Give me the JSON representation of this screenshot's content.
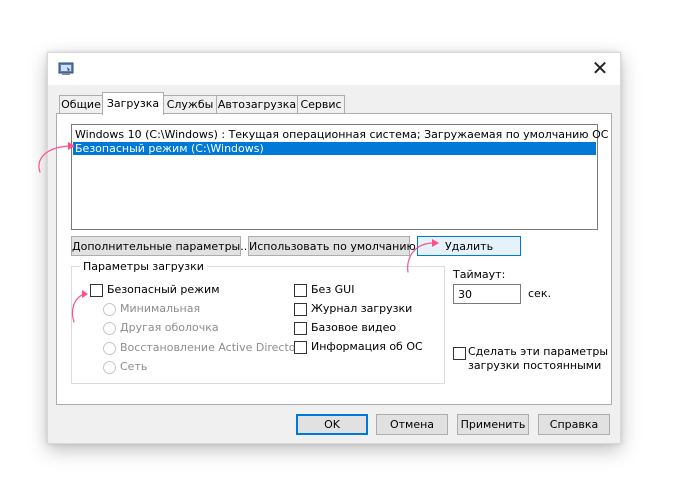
{
  "dialog": {
    "close_glyph": "✕",
    "tabs": [
      {
        "label": "Общие"
      },
      {
        "label": "Загрузка"
      },
      {
        "label": "Службы"
      },
      {
        "label": "Автозагрузка"
      },
      {
        "label": "Сервис"
      }
    ],
    "active_tab": "Загрузка"
  },
  "boot": {
    "os_entries": [
      {
        "label": "Windows 10 (C:\\Windows) : Текущая операционная система; Загружаемая по умолчанию ОС",
        "selected": false
      },
      {
        "label": "Безопасный режим (C:\\Windows)",
        "selected": true
      }
    ],
    "buttons": {
      "advanced": "Дополнительные параметры...",
      "set_default": "Использовать по умолчанию",
      "delete": "Удалить"
    },
    "options_group": {
      "title": "Параметры загрузки",
      "safe_boot": {
        "label": "Безопасный режим",
        "checked": false
      },
      "radios": [
        {
          "label": "Минимальная"
        },
        {
          "label": "Другая оболочка"
        },
        {
          "label": "Восстановление Active Directory"
        },
        {
          "label": "Сеть"
        }
      ],
      "checkboxes": [
        {
          "label": "Без GUI",
          "checked": false
        },
        {
          "label": "Журнал загрузки",
          "checked": false
        },
        {
          "label": "Базовое видео",
          "checked": false
        },
        {
          "label": "Информация  об ОС",
          "checked": false
        }
      ]
    },
    "timeout": {
      "label": "Таймаут:",
      "value": "30",
      "unit": "сек."
    },
    "persist": {
      "label_line1": "Сделать эти параметры",
      "label_line2": "загрузки постоянными",
      "checked": false
    }
  },
  "footer": {
    "ok": "OK",
    "cancel": "Отмена",
    "apply": "Применить",
    "help": "Справка"
  },
  "colors": {
    "selection": "#0078d7",
    "annotation": "#ff4f8b"
  }
}
